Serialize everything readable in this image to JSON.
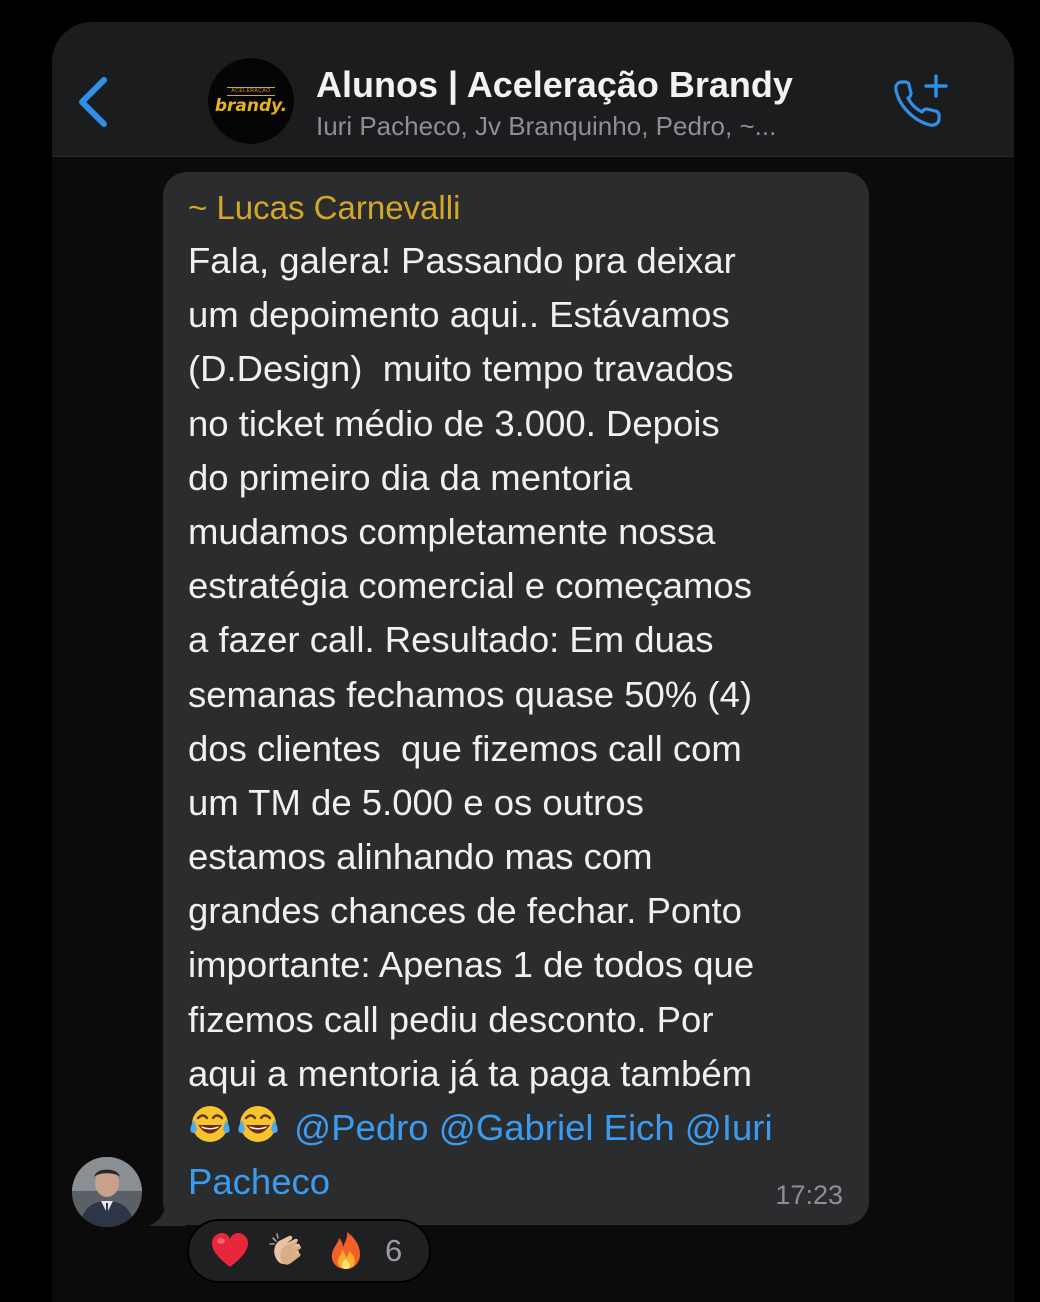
{
  "header": {
    "group_name": "Alunos | Aceleração Brandy",
    "members_preview": "Iuri Pacheco, Jv Branquinho, Pedro, ~...",
    "logo_small_text": "ACELERAÇÃO",
    "logo_text": "brandy."
  },
  "message": {
    "sender": "~ Lucas Carnevalli",
    "lines": [
      "Fala, galera! Passando pra deixar",
      "um depoimento aqui.. Estávamos",
      "(D.Design)  muito tempo travados",
      "no ticket médio de 3.000. Depois",
      "do primeiro dia da mentoria",
      "mudamos completamente nossa",
      "estratégia comercial e começamos",
      "a fazer call. Resultado: Em duas",
      "semanas fechamos quase 50% (4)",
      "dos clientes  que fizemos call com",
      "um TM de 5.000 e os outros",
      "estamos alinhando mas com",
      "grandes chances de fechar. Ponto",
      "importante: Apenas 1 de todos que",
      "fizemos call pediu desconto. Por",
      "aqui a mentoria já ta paga também"
    ],
    "emojis": [
      "face-with-tears-of-joy",
      "face-with-tears-of-joy"
    ],
    "mentions": [
      "@Pedro",
      "@Gabriel Eich",
      "@Iuri"
    ],
    "mention_continuation": "Pacheco",
    "time": "17:23"
  },
  "reactions": {
    "items": [
      "red-heart",
      "clapping-hands",
      "fire"
    ],
    "count": "6"
  },
  "colors": {
    "accent_blue": "#3a9bef",
    "sender_gold": "#d6a626",
    "bubble_bg": "#2b2c2e",
    "header_bg": "#1b1c1e"
  }
}
